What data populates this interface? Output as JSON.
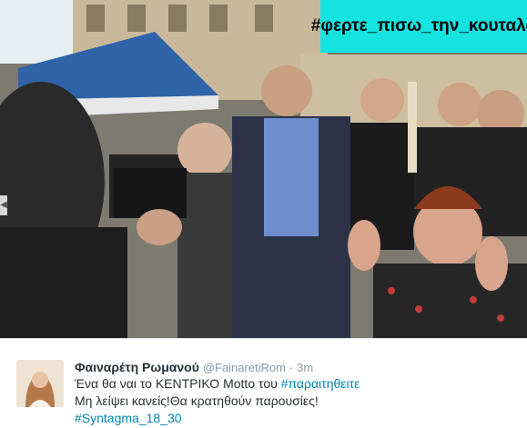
{
  "photo": {
    "banner_hashtag": "#φερτε_πισω_την_κουταλα"
  },
  "tweet": {
    "display_name": "Φαιναρέτη Ρωμανού",
    "handle": "@FainaretiRom",
    "separator": "·",
    "time": "3m",
    "line1_text": "Ένα θα ναι το ΚΕΝΤΡΙΚΟ Motto του ",
    "line1_hashtag": "#παραιτηθειτε",
    "line2_text": "Μη λείψει κανείς!Θα κρατηθούν παρουσίες!",
    "line3_hashtag": "#Syntagma_18_30"
  },
  "colors": {
    "banner_bg": "#14e3e0",
    "link": "#0084b4",
    "muted": "#8899a6",
    "text": "#292f33"
  }
}
